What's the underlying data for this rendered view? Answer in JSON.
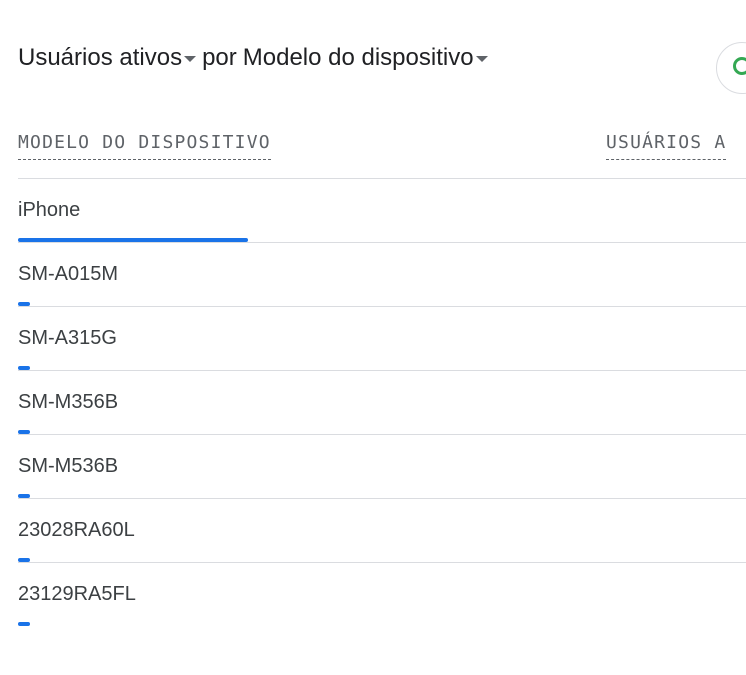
{
  "title": {
    "metric": "Usuários ativos",
    "connector": "por",
    "dimension": "Modelo do dispositivo"
  },
  "table": {
    "columns": [
      "MODELO DO DISPOSITIVO",
      "USUÁRIOS A"
    ],
    "rows": [
      {
        "label": "iPhone",
        "share": 1.0
      },
      {
        "label": "SM-A015M",
        "share": 0.05
      },
      {
        "label": "SM-A315G",
        "share": 0.05
      },
      {
        "label": "SM-M356B",
        "share": 0.05
      },
      {
        "label": "SM-M536B",
        "share": 0.05
      },
      {
        "label": "23028RA60L",
        "share": 0.05
      },
      {
        "label": "23129RA5FL",
        "share": 0.05
      }
    ]
  },
  "icons": {
    "round_button": "google-circle-icon"
  },
  "colors": {
    "bar": "#1a73e8",
    "icon_ring": "#34a853"
  }
}
